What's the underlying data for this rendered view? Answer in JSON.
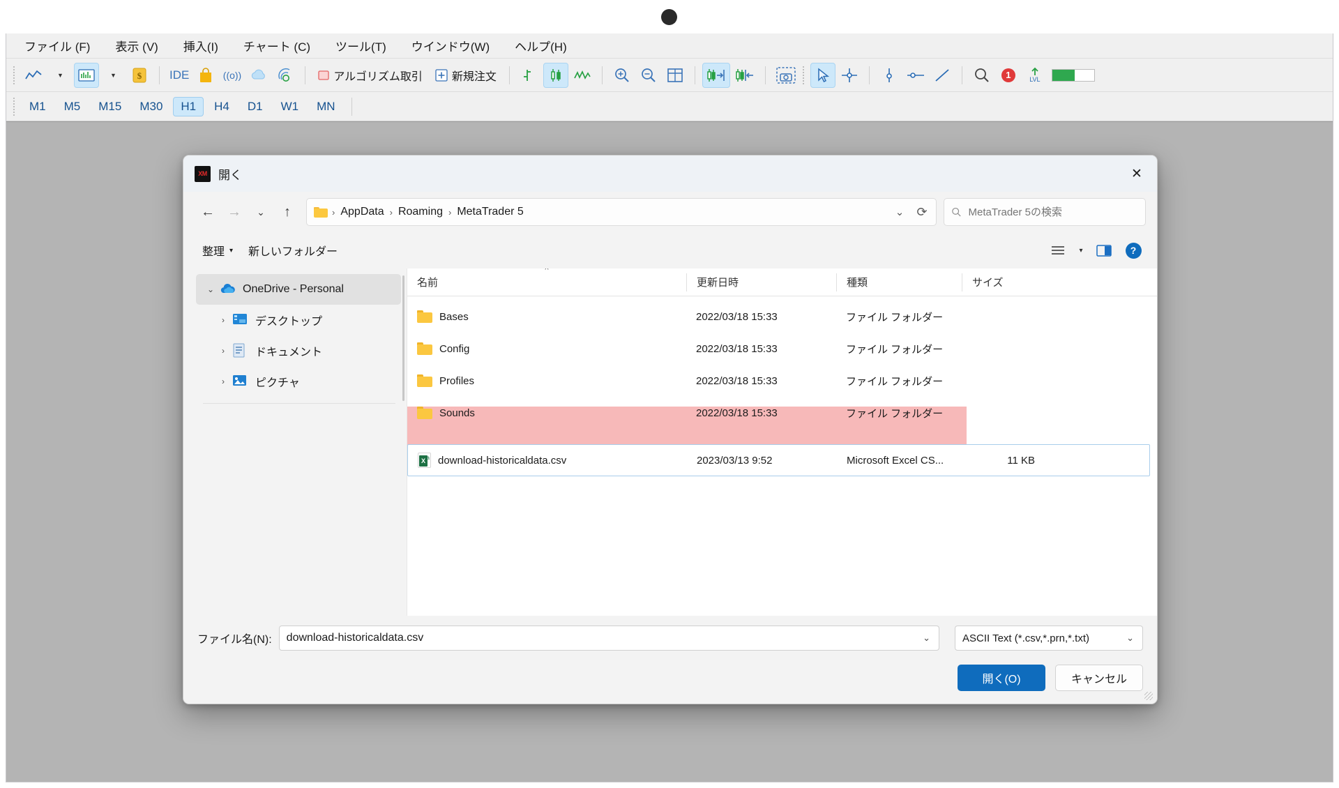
{
  "app": {
    "menu": [
      {
        "label": "ファイル (F)",
        "name": "menu-file"
      },
      {
        "label": "表示 (V)",
        "name": "menu-view"
      },
      {
        "label": "挿入(I)",
        "name": "menu-insert"
      },
      {
        "label": "チャート (C)",
        "name": "menu-chart"
      },
      {
        "label": "ツール(T)",
        "name": "menu-tools"
      },
      {
        "label": "ウインドウ(W)",
        "name": "menu-window"
      },
      {
        "label": "ヘルプ(H)",
        "name": "menu-help"
      }
    ],
    "toolbar": {
      "ide_label": "IDE",
      "algo_label": "アルゴリズム取引",
      "neworder_label": "新規注文",
      "alert_badge": "1",
      "lvl_label": "LVL"
    },
    "periods": [
      {
        "label": "M1",
        "active": false
      },
      {
        "label": "M5",
        "active": false
      },
      {
        "label": "M15",
        "active": false
      },
      {
        "label": "M30",
        "active": false
      },
      {
        "label": "H1",
        "active": true
      },
      {
        "label": "H4",
        "active": false
      },
      {
        "label": "D1",
        "active": false
      },
      {
        "label": "W1",
        "active": false
      },
      {
        "label": "MN",
        "active": false
      }
    ]
  },
  "dialog": {
    "title": "開く",
    "icon_text": "XM",
    "close_label": "✕",
    "address": {
      "crumbs": [
        "AppData",
        "Roaming",
        "MetaTrader 5"
      ],
      "separator": "›",
      "dropdown_label": "⌄",
      "refresh_label": "⟳"
    },
    "search": {
      "placeholder": "MetaTrader 5の検索",
      "value": ""
    },
    "commands": {
      "organize_label": "整理",
      "organize_caret": "▾",
      "newfolder_label": "新しいフォルダー",
      "view_caret": "▾",
      "help_label": "?"
    },
    "sidebar": {
      "items": [
        {
          "label": "OneDrive - Personal",
          "icon": "onedrive-cloud-icon",
          "expanded": true,
          "selected": true,
          "indent": 0
        },
        {
          "label": "デスクトップ",
          "icon": "desktop-icon",
          "expanded": false,
          "selected": false,
          "indent": 1
        },
        {
          "label": "ドキュメント",
          "icon": "documents-icon",
          "expanded": false,
          "selected": false,
          "indent": 1
        },
        {
          "label": "ピクチャ",
          "icon": "pictures-icon",
          "expanded": false,
          "selected": false,
          "indent": 1
        }
      ],
      "chevron_expanded": "⌄",
      "chevron_collapsed": "›"
    },
    "filelist": {
      "columns": [
        {
          "label": "名前",
          "key": "name",
          "sorted": true,
          "sort_mark": "^"
        },
        {
          "label": "更新日時",
          "key": "date",
          "sorted": false,
          "sort_mark": ""
        },
        {
          "label": "種類",
          "key": "type",
          "sorted": false,
          "sort_mark": ""
        },
        {
          "label": "サイズ",
          "key": "size",
          "sorted": false,
          "sort_mark": ""
        }
      ],
      "rows": [
        {
          "name": "Bases",
          "date": "2022/03/18 15:33",
          "type": "ファイル フォルダー",
          "size": "",
          "icon": "folder-icon",
          "selected": false
        },
        {
          "name": "Config",
          "date": "2022/03/18 15:33",
          "type": "ファイル フォルダー",
          "size": "",
          "icon": "folder-icon",
          "selected": false
        },
        {
          "name": "Profiles",
          "date": "2022/03/18 15:33",
          "type": "ファイル フォルダー",
          "size": "",
          "icon": "folder-icon",
          "selected": false
        },
        {
          "name": "Sounds",
          "date": "2022/03/18 15:33",
          "type": "ファイル フォルダー",
          "size": "",
          "icon": "folder-icon",
          "selected": false
        },
        {
          "name": "download-historicaldata.csv",
          "date": "2023/03/13 9:52",
          "type": "Microsoft Excel CS...",
          "size": "11 KB",
          "icon": "excel-csv-icon",
          "selected": true
        }
      ]
    },
    "footer": {
      "filename_label": "ファイル名(N):",
      "filename_value": "download-historicaldata.csv",
      "filename_caret": "⌄",
      "filetype_value": "ASCII Text (*.csv,*.prn,*.txt)",
      "filetype_caret": "⌄",
      "open_button": "開く(O)",
      "cancel_button": "キャンセル"
    }
  },
  "colors": {
    "accent": "#0f6cbd",
    "highlight_pink": "#f7b9b9",
    "toolbar_active": "#cde8fa",
    "workspace_gray": "#b4b4b4",
    "mt5_blue": "#16528f"
  }
}
